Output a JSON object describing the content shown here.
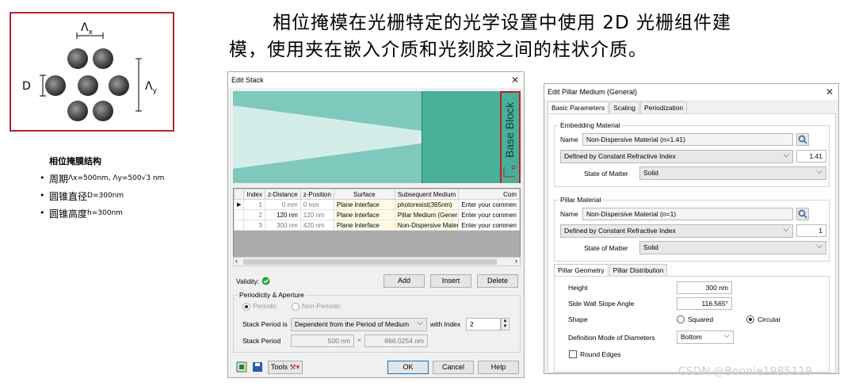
{
  "schematic": {
    "lambda_x": "Λ",
    "lambda_x_sub": "x",
    "lambda_y": "Λ",
    "lambda_y_sub": "y",
    "d_label": "D",
    "border_color": "#b0262e"
  },
  "caption": "相位掩膜结构",
  "bullets": [
    {
      "cn": "周期",
      "val": "Λx=500nm,  Λy=500√3 nm"
    },
    {
      "cn": "圆锥直径",
      "val": "D=300nm"
    },
    {
      "cn": "圆锥高度",
      "val": "h=300nm"
    }
  ],
  "heading": {
    "line1": "相位掩模在光栅特定的光学设置中使用 2D 光栅组件建",
    "line2": "模，使用夹在嵌入介质和光刻胶之间的柱状介质。"
  },
  "edit_stack": {
    "title": "Edit Stack",
    "close": "✕",
    "base_block": "Base Block",
    "columns": [
      "Index",
      "z-Distance",
      "z-Position",
      "Surface",
      "Subsequent Medium",
      "Com"
    ],
    "rows": [
      {
        "marker": "▶",
        "index": "1",
        "zdist": "0 mm",
        "zpos": "0 mm",
        "surface": "Plane Interface",
        "medium": "photoresist(365nm)",
        "comment": "Enter your commen"
      },
      {
        "marker": "",
        "index": "2",
        "zdist": "120 nm",
        "zpos": "120 nm",
        "surface": "Plane Interface",
        "medium": "Pillar Medium (Genera",
        "comment": "Enter your commen"
      },
      {
        "marker": "",
        "index": "3",
        "zdist": "300 nm",
        "zpos": "420 nm",
        "surface": "Plane Interface",
        "medium": "Non-Dispersive Mater",
        "comment": "Enter your commen"
      }
    ],
    "validity_label": "Validity:",
    "add": "Add",
    "insert": "Insert",
    "delete": "Delete",
    "periodicity_title": "Periodicity & Aperture",
    "periodic": "Periodic",
    "non_periodic": "Non-Periodic",
    "stack_period_is": "Stack Period is",
    "stack_period_mode": "Dependent from the Period of Medium",
    "with_index": "with Index",
    "index_value": "2",
    "stack_period": "Stack Period",
    "period_x": "500 nm",
    "times": "×",
    "period_y": "866.0254 nm",
    "tools": "Tools",
    "ok": "OK",
    "cancel": "Cancel",
    "help": "Help"
  },
  "edit_pillar": {
    "title": "Edit Pillar Medium (General)",
    "close": "✕",
    "tabs": [
      "Basic Parameters",
      "Scaling",
      "Periodization"
    ],
    "embedding_title": "Embedding Material",
    "name_label": "Name",
    "embedding_name": "Non-Dispersive Material (n=1.41)",
    "embedding_def": "Defined by Constant Refractive Index",
    "embedding_n": "1.41",
    "state_label": "State of Matter",
    "embedding_state": "Solid",
    "pillar_title": "Pillar Material",
    "pillar_name": "Non-Dispersive Material (n=1)",
    "pillar_def": "Defined by Constant Refractive Index",
    "pillar_n": "1",
    "pillar_state": "Solid",
    "geo_tabs": [
      "Pillar Geometry",
      "Pillar Distribution"
    ],
    "height_label": "Height",
    "height": "300 nm",
    "slope_label": "Side Wall Slope Angle",
    "slope": "116.565°",
    "shape_label": "Shape",
    "squared": "Squared",
    "circular": "Circular",
    "diam_label": "Definition Mode of Diameters",
    "diam_mode": "Bottom",
    "round_edges": "Round Edges"
  },
  "watermark": "CSDN @Bonnie1985119"
}
